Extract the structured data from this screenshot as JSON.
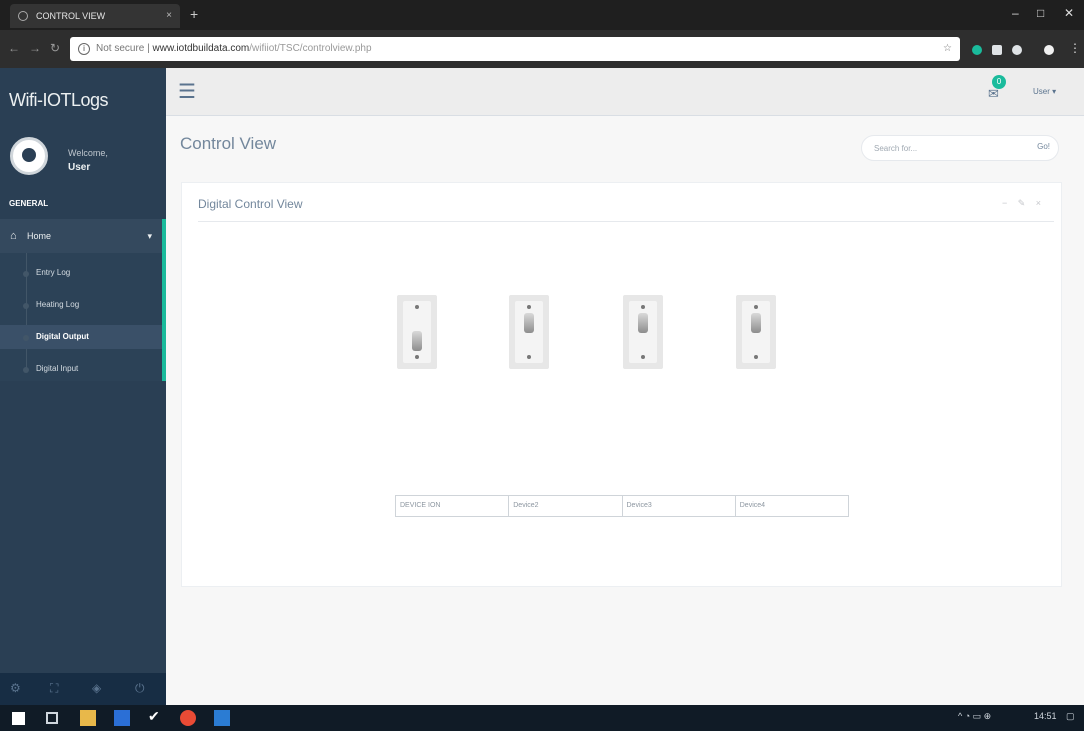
{
  "browser": {
    "tab_title": "CONTROL VIEW",
    "tab_close": "×",
    "new_tab": "+",
    "not_secure": "Not secure",
    "url_domain": "www.iotdbuildata.com",
    "url_path": "/wifiiot/TSC/controlview.php"
  },
  "app": {
    "brand": "Wifi-IOTLogs",
    "welcome": "Welcome,",
    "username": "User",
    "section": "GENERAL",
    "menu_home": "Home",
    "submenu": [
      "Entry Log",
      "Heating Log",
      "Digital Output",
      "Digital Input"
    ],
    "notification_count": "0",
    "user_menu": "User ▾"
  },
  "page": {
    "title": "Control View",
    "search_placeholder": "Search for...",
    "go_label": "Go!",
    "panel_title": "Digital Control View",
    "panel_tools": "− ✎ ×"
  },
  "devices": {
    "switches": [
      {
        "name": "DEVICE ION",
        "state": "off"
      },
      {
        "name": "Device2",
        "state": "on"
      },
      {
        "name": "Device3",
        "state": "on"
      },
      {
        "name": "Device4",
        "state": "on"
      }
    ]
  },
  "taskbar": {
    "clock": "14:51"
  },
  "icons": {
    "hamburger": "☰",
    "bell": "🔔",
    "home": "⌂",
    "chevron": "▾"
  },
  "colors": {
    "sidebar": "#2a3f54",
    "accent": "#1abb9c"
  }
}
